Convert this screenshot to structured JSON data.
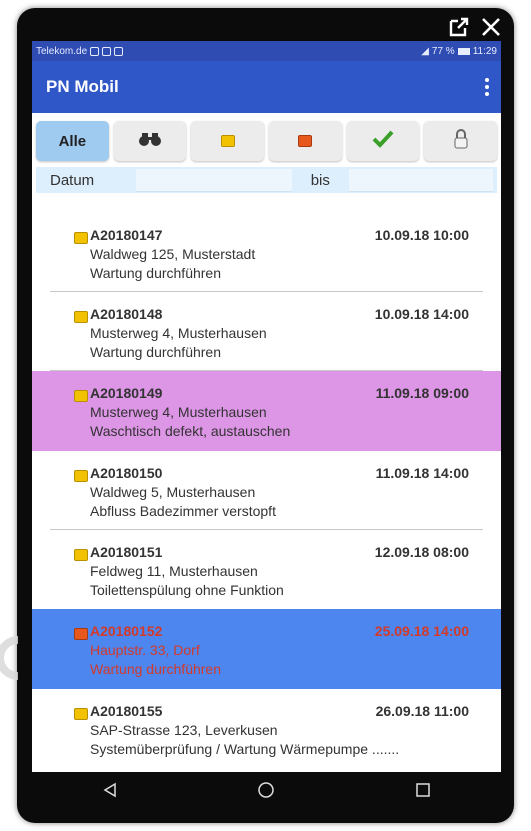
{
  "window_controls": {
    "popout_icon": "popout-icon",
    "close_icon": "close-icon"
  },
  "statusbar": {
    "carrier": "Telekom.de",
    "right": "77 %",
    "time": "11:29"
  },
  "appbar": {
    "title": "PN Mobil",
    "menu_icon": "more-vertical-icon"
  },
  "filters": [
    {
      "label": "Alle",
      "active": true
    },
    {
      "icon": "binoculars-icon"
    },
    {
      "icon": "yellow-square-icon"
    },
    {
      "icon": "orange-square-icon"
    },
    {
      "icon": "checkmark-icon"
    },
    {
      "icon": "lock-icon"
    }
  ],
  "daterow": {
    "from_label": "Datum",
    "to_label": "bis",
    "from_value": "",
    "to_value": ""
  },
  "orders": [
    {
      "id": "A20180147",
      "date": "10.09.18 10:00",
      "address": "Waldweg 125, Musterstadt",
      "task": "Wartung durchführen",
      "status": "yellow",
      "highlight": ""
    },
    {
      "id": "A20180148",
      "date": "10.09.18 14:00",
      "address": "Musterweg 4, Musterhausen",
      "task": "Wartung durchführen",
      "status": "yellow",
      "highlight": ""
    },
    {
      "id": "A20180149",
      "date": "11.09.18 09:00",
      "address": "Musterweg 4, Musterhausen",
      "task": "Waschtisch defekt, austauschen",
      "status": "yellow",
      "highlight": "pink"
    },
    {
      "id": "A20180150",
      "date": "11.09.18 14:00",
      "address": "Waldweg 5, Musterhausen",
      "task": "Abfluss Badezimmer verstopft",
      "status": "yellow",
      "highlight": ""
    },
    {
      "id": "A20180151",
      "date": "12.09.18 08:00",
      "address": "Feldweg 11, Musterhausen",
      "task": "Toilettenspülung ohne Funktion",
      "status": "yellow",
      "highlight": ""
    },
    {
      "id": "A20180152",
      "date": "25.09.18 14:00",
      "address": "Hauptstr. 33, Dorf",
      "task": "Wartung durchführen",
      "status": "orange",
      "highlight": "blue"
    },
    {
      "id": "A20180155",
      "date": "26.09.18 11:00",
      "address": "SAP-Strasse 123, Leverkusen",
      "task": "Systemüberprüfung / Wartung Wärmepumpe .......",
      "status": "yellow",
      "highlight": ""
    }
  ],
  "colors": {
    "yellow": "#f2c200",
    "orange": "#e8581d",
    "pink": "#dd95e6",
    "blue": "#4d86ef",
    "appbar": "#2f57c8"
  },
  "navbar": {
    "back_icon": "back-icon",
    "home_icon": "home-icon",
    "recents_icon": "recents-icon"
  }
}
